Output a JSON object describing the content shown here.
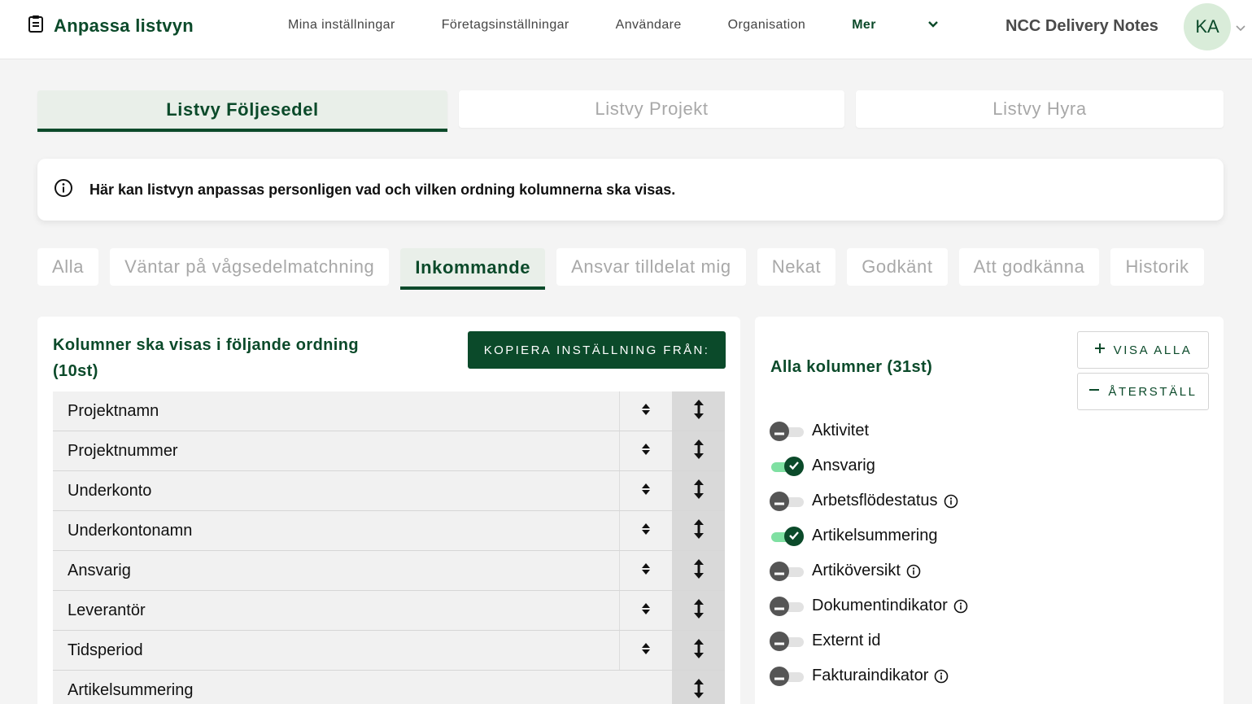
{
  "header": {
    "title": "Anpassa listvyn",
    "nav": [
      "Mina inställningar",
      "Företagsinställningar",
      "Användare",
      "Organisation"
    ],
    "more_label": "Mer",
    "org_name": "NCC Delivery Notes",
    "avatar_initials": "KA"
  },
  "view_tabs": [
    {
      "label": "Listvy Följesedel",
      "active": true
    },
    {
      "label": "Listvy Projekt",
      "active": false
    },
    {
      "label": "Listvy Hyra",
      "active": false
    }
  ],
  "info_text": "Här kan listvyn anpassas personligen vad och vilken ordning kolumnerna ska visas.",
  "filter_tabs": [
    {
      "label": "Alla",
      "active": false
    },
    {
      "label": "Väntar på vågsedelmatchning",
      "active": false
    },
    {
      "label": "Inkommande",
      "active": true
    },
    {
      "label": "Ansvar tilldelat mig",
      "active": false
    },
    {
      "label": "Nekat",
      "active": false
    },
    {
      "label": "Godkänt",
      "active": false
    },
    {
      "label": "Att godkänna",
      "active": false
    },
    {
      "label": "Historik",
      "active": false
    }
  ],
  "left_panel": {
    "title": "Kolumner ska visas i följande ordning (10st)",
    "copy_button": "KOPIERA INSTÄLLNING FRÅN:",
    "rows": [
      {
        "label": "Projektnamn",
        "sortable": true
      },
      {
        "label": "Projektnummer",
        "sortable": true
      },
      {
        "label": "Underkonto",
        "sortable": true
      },
      {
        "label": "Underkontonamn",
        "sortable": true
      },
      {
        "label": "Ansvarig",
        "sortable": true
      },
      {
        "label": "Leverantör",
        "sortable": true
      },
      {
        "label": "Tidsperiod",
        "sortable": true
      },
      {
        "label": "Artikelsummering",
        "sortable": false
      }
    ]
  },
  "right_panel": {
    "title": "Alla kolumner (31st)",
    "show_all_button": "VISA ALLA",
    "reset_button": "ÅTERSTÄLL",
    "columns": [
      {
        "label": "Aktivitet",
        "on": false,
        "info": false
      },
      {
        "label": "Ansvarig",
        "on": true,
        "info": false
      },
      {
        "label": "Arbetsflödestatus",
        "on": false,
        "info": true
      },
      {
        "label": "Artikelsummering",
        "on": true,
        "info": false
      },
      {
        "label": "Artiköversikt",
        "on": false,
        "info": true
      },
      {
        "label": "Dokumentindikator",
        "on": false,
        "info": true
      },
      {
        "label": "Externt id",
        "on": false,
        "info": false
      },
      {
        "label": "Fakturaindikator",
        "on": false,
        "info": true
      }
    ]
  },
  "colors": {
    "brand_green": "#0b4a2a",
    "toggle_on_track": "#7fe0a2"
  }
}
